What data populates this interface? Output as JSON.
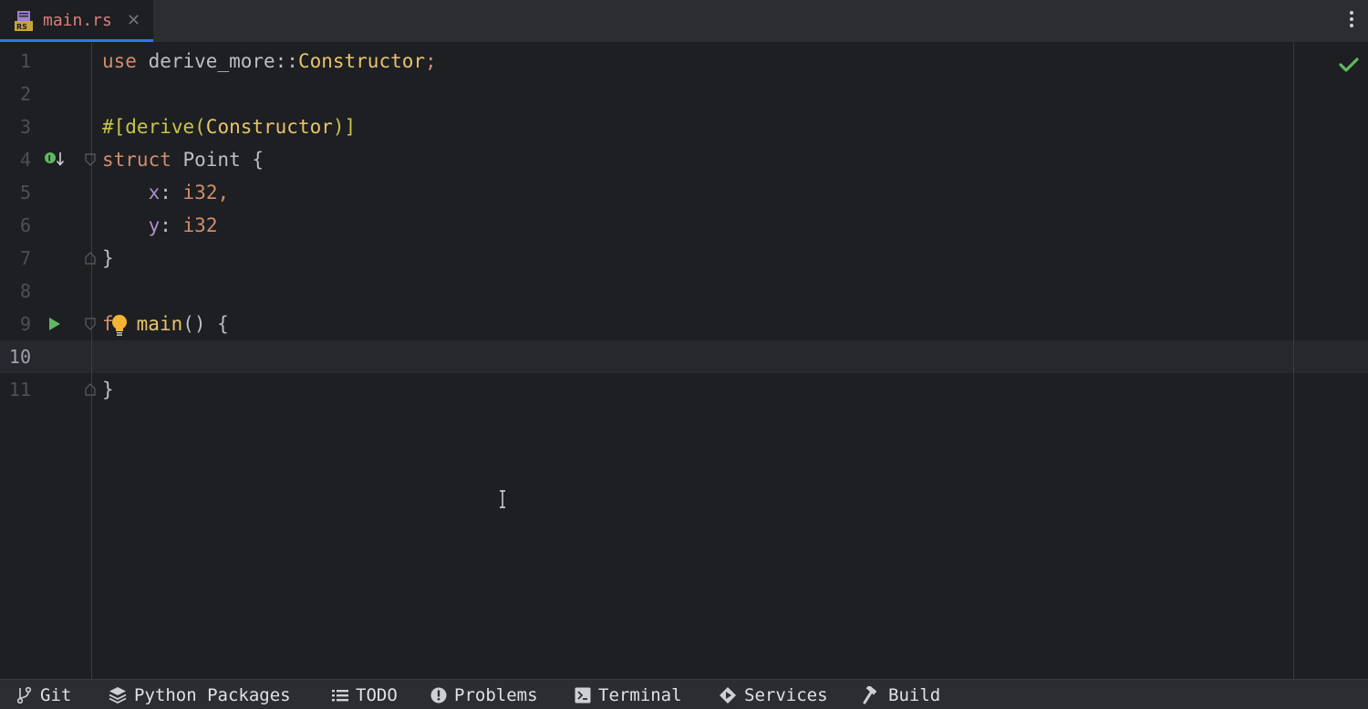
{
  "tab": {
    "file_icon": "rust-file-icon",
    "label": "main.rs",
    "close_glyph": "✕"
  },
  "gutter": {
    "line_numbers": [
      "1",
      "2",
      "3",
      "4",
      "5",
      "6",
      "7",
      "8",
      "9",
      "10",
      "11"
    ],
    "current_line": "10"
  },
  "code": {
    "l1": {
      "kw": "use",
      "path": " derive_more::",
      "type": "Constructor",
      "end": ";"
    },
    "l3": {
      "attr_open": "#[derive(",
      "type": "Constructor",
      "attr_close": ")]"
    },
    "l4": {
      "kw": "struct",
      "name": " Point",
      "brace": " {"
    },
    "l5": {
      "indent": "    ",
      "field": "x",
      "colon": ": ",
      "type": "i32",
      "comma": ","
    },
    "l6": {
      "indent": "    ",
      "field": "y",
      "colon": ": ",
      "type": "i32"
    },
    "l7": {
      "brace": "}"
    },
    "l9": {
      "kw": "f",
      "name": "main",
      "rest": "() {"
    },
    "l11": {
      "brace": "}"
    }
  },
  "status": {
    "inspection": "check-icon"
  },
  "bottom_bar": {
    "items": [
      {
        "icon": "git-branch-icon",
        "label": "Git"
      },
      {
        "icon": "python-packages-icon",
        "label": "Python Packages"
      },
      {
        "icon": "list-icon",
        "label": "TODO"
      },
      {
        "icon": "problems-icon",
        "label": "Problems"
      },
      {
        "icon": "terminal-icon",
        "label": "Terminal"
      },
      {
        "icon": "services-icon",
        "label": "Services"
      },
      {
        "icon": "hammer-icon",
        "label": "Build"
      }
    ]
  },
  "colors": {
    "background": "#1e1f22",
    "tab_underline": "#3574f0",
    "keyword": "#cf8e6d",
    "type": "#e8c46a",
    "success": "#5fb85f"
  }
}
